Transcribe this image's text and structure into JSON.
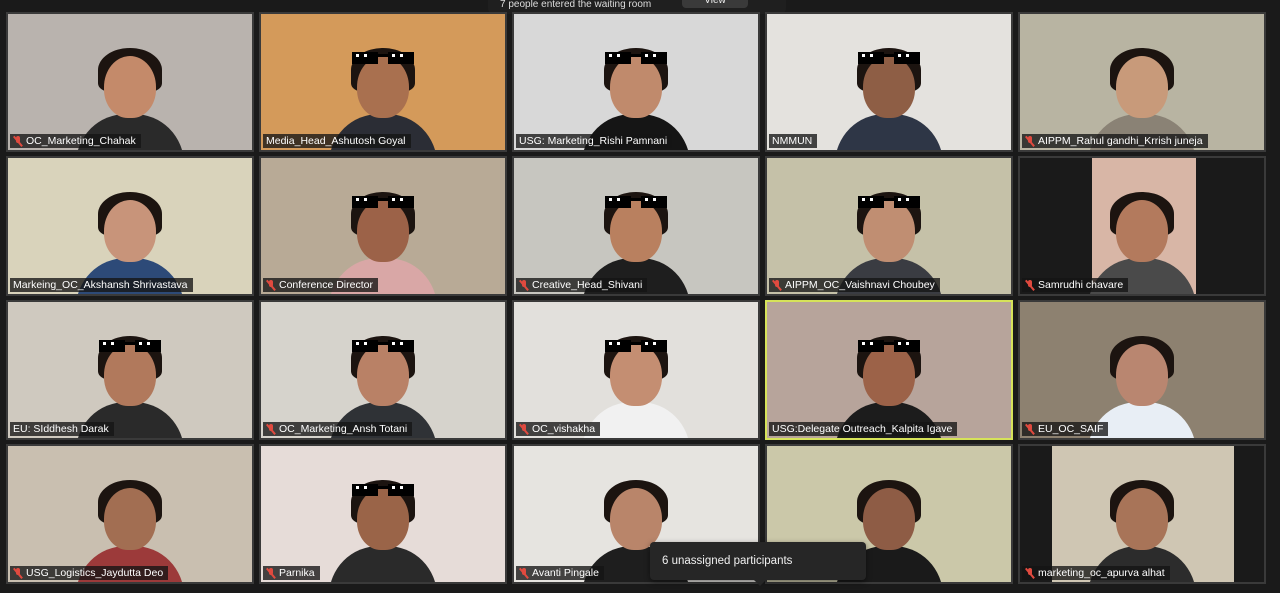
{
  "banner": {
    "text": "7 people entered the waiting room",
    "view_label": "View"
  },
  "tooltip": {
    "text": "6 unassigned participants"
  },
  "participants": [
    {
      "name": "OC_Marketing_Chahak",
      "muted": true,
      "shades": false,
      "bg": "#b9b3ae",
      "skin": "#c48a6a",
      "shirt": "#2a2a2a",
      "hair": true
    },
    {
      "name": "Media_Head_Ashutosh Goyal",
      "muted": false,
      "shades": true,
      "bg": "#d49a5a",
      "skin": "#a9704f",
      "shirt": "#2b2d35",
      "hair": true
    },
    {
      "name": "USG: Marketing_Rishi Pamnani",
      "muted": false,
      "shades": true,
      "bg": "#d8d8d8",
      "skin": "#c08a6c",
      "shirt": "#151515",
      "hair": true
    },
    {
      "name": "NMMUN",
      "muted": false,
      "shades": true,
      "bg": "#e4e2de",
      "skin": "#8e5e45",
      "shirt": "#2e3646",
      "hair": true
    },
    {
      "name": "AIPPM_Rahul gandhi_Krrish juneja",
      "muted": true,
      "shades": false,
      "bg": "#b8b4a2",
      "skin": "#c89a7a",
      "shirt": "#8a8275",
      "hair": true
    },
    {
      "name": "Markeing_OC_Akshansh Shrivastava",
      "muted": false,
      "shades": false,
      "bg": "#d9d3bb",
      "skin": "#c8947a",
      "shirt": "#2d4a78",
      "hair": true
    },
    {
      "name": "Conference Director",
      "muted": true,
      "shades": true,
      "bg": "#b8aa96",
      "skin": "#9c6248",
      "shirt": "#d9a7a6",
      "hair": true
    },
    {
      "name": "Creative_Head_Shivani",
      "muted": true,
      "shades": true,
      "bg": "#c7c6c0",
      "skin": "#b9805f",
      "shirt": "#1e1e1e",
      "hair": true
    },
    {
      "name": "AIPPM_OC_Vaishnavi Choubey",
      "muted": true,
      "shades": true,
      "bg": "#c5c1a8",
      "skin": "#c08e72",
      "shirt": "#3a3c42",
      "hair": true
    },
    {
      "name": "Samrudhi chavare",
      "muted": true,
      "shades": false,
      "bg": "#1a1a1a",
      "skin": "#b37a5d",
      "shirt": "#4a4a4a",
      "hair": true
    },
    {
      "name": "EU: SIddhesh Darak",
      "muted": false,
      "shades": true,
      "bg": "#cfc9bf",
      "skin": "#b1795c",
      "shirt": "#2a2a2a",
      "hair": true
    },
    {
      "name": "OC_Marketing_Ansh Totani",
      "muted": true,
      "shades": true,
      "bg": "#d6d3cc",
      "skin": "#b98166",
      "shirt": "#2f3236",
      "hair": true
    },
    {
      "name": "OC_vishakha",
      "muted": true,
      "shades": true,
      "bg": "#e2e0dc",
      "skin": "#c48e72",
      "shirt": "#f1f1f1",
      "hair": true
    },
    {
      "name": "USG:Delegate Outreach_Kalpita Igave",
      "muted": false,
      "shades": true,
      "bg": "#b7a49b",
      "skin": "#9c6248",
      "shirt": "#1c1c1c",
      "hair": true,
      "active": true
    },
    {
      "name": "EU_OC_SAIF",
      "muted": true,
      "shades": false,
      "bg": "#8d8170",
      "skin": "#b98670",
      "shirt": "#e8eef5",
      "hair": true
    },
    {
      "name": "USG_Logistics_Jaydutta Deo",
      "muted": true,
      "shades": false,
      "bg": "#c9bfb0",
      "skin": "#a26e52",
      "shirt": "#9c3a3a",
      "hair": true
    },
    {
      "name": "Parnika",
      "muted": true,
      "shades": true,
      "bg": "#e6dcd8",
      "skin": "#9a6448",
      "shirt": "#2a2a2a",
      "hair": true
    },
    {
      "name": "Avanti Pingale",
      "muted": true,
      "shades": false,
      "bg": "#e6e4e0",
      "skin": "#b9856a",
      "shirt": "#1e1e1e",
      "hair": true
    },
    {
      "name": "",
      "muted": false,
      "shades": false,
      "bg": "#cbc8a9",
      "skin": "#8e5c45",
      "shirt": "#1a1a1a",
      "hair": true
    },
    {
      "name": "marketing_oc_apurva alhat",
      "muted": true,
      "shades": false,
      "bg": "#1a1a1a",
      "skin": "#a87458",
      "shirt": "#2c2c2c",
      "hair": true
    }
  ]
}
